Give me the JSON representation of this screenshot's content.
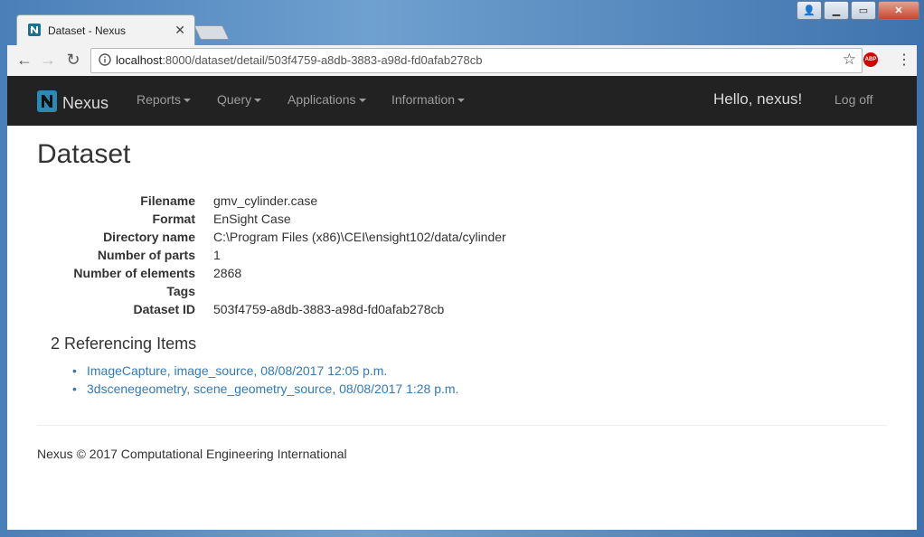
{
  "browser": {
    "tab_title": "Dataset - Nexus",
    "url_host": "localhost",
    "url_rest": ":8000/dataset/detail/503f4759-a8db-3883-a98d-fd0afab278cb",
    "abp_label": "ABP"
  },
  "navbar": {
    "brand": "Nexus",
    "items": [
      "Reports",
      "Query",
      "Applications",
      "Information"
    ],
    "greeting": "Hello, nexus!",
    "logoff": "Log off"
  },
  "page": {
    "title": "Dataset",
    "details": [
      {
        "label": "Filename",
        "value": "gmv_cylinder.case"
      },
      {
        "label": "Format",
        "value": "EnSight Case"
      },
      {
        "label": "Directory name",
        "value": "C:\\Program Files (x86)\\CEI\\ensight102/data/cylinder"
      },
      {
        "label": "Number of parts",
        "value": "1"
      },
      {
        "label": "Number of elements",
        "value": "2868"
      },
      {
        "label": "Tags",
        "value": ""
      },
      {
        "label": "Dataset ID",
        "value": "503f4759-a8db-3883-a98d-fd0afab278cb"
      }
    ],
    "referencing_heading": "2 Referencing Items",
    "referencing_items": [
      "ImageCapture, image_source, 08/08/2017 12:05 p.m.",
      "3dscenegeometry, scene_geometry_source, 08/08/2017 1:28 p.m."
    ],
    "footer": "Nexus © 2017 Computational Engineering International"
  },
  "colors": {
    "navbar_bg": "#222222",
    "link": "#337ab7",
    "brand_logo": "#2a8ab4"
  }
}
